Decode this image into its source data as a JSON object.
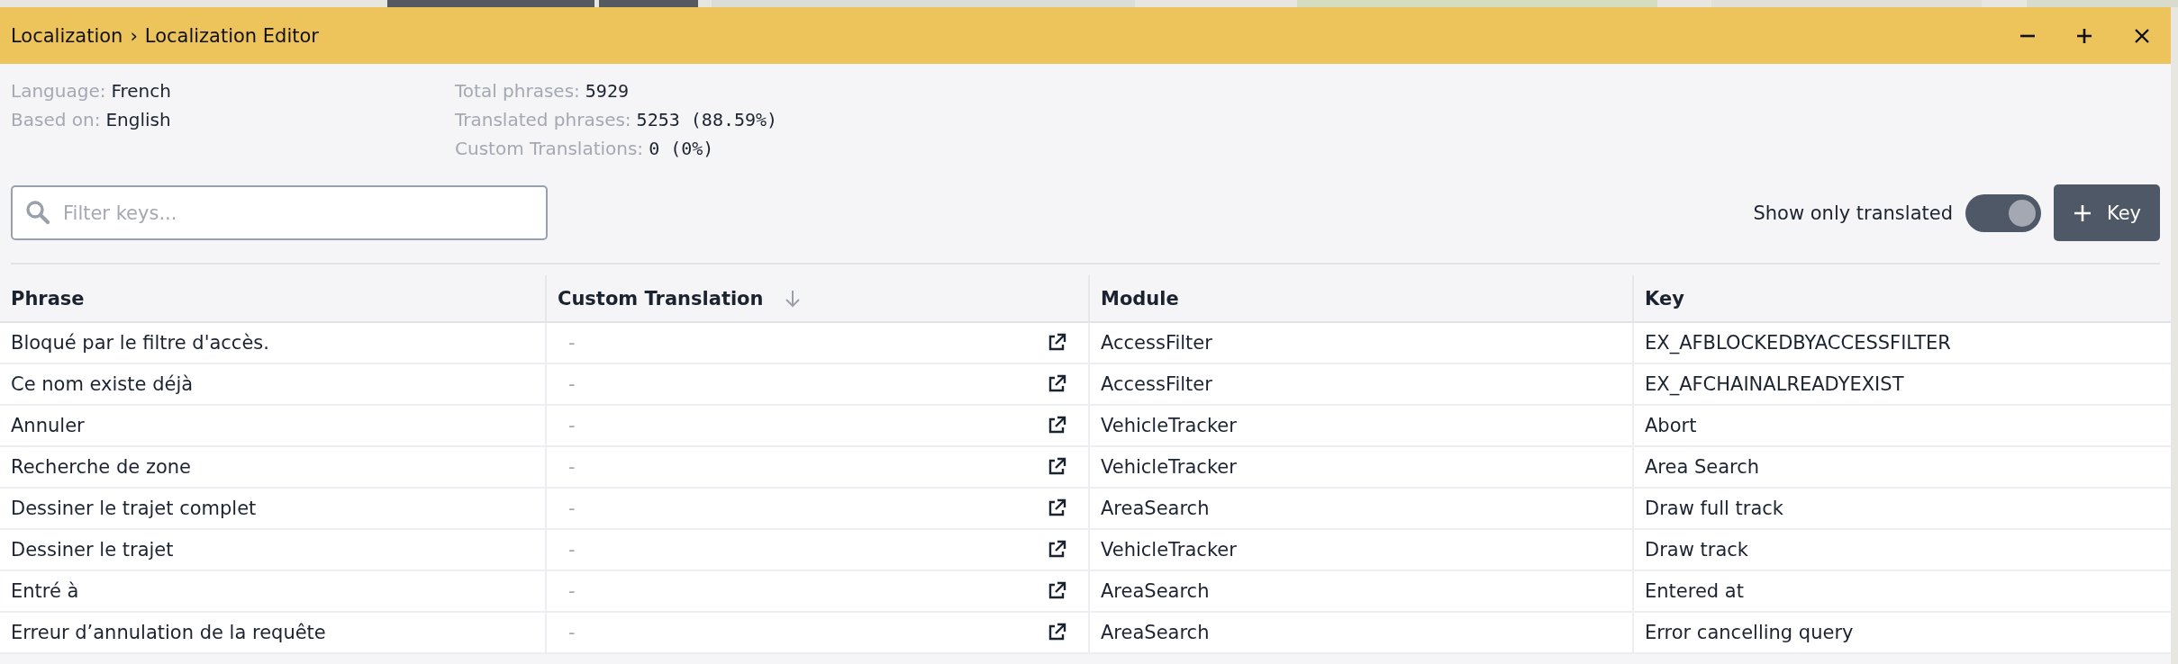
{
  "window": {
    "breadcrumb": [
      "Localization",
      "Localization Editor"
    ],
    "separator": "›",
    "controls": [
      {
        "kind": "minimize"
      },
      {
        "kind": "maximize"
      },
      {
        "kind": "close"
      }
    ]
  },
  "info_left": [
    {
      "label": "Language:",
      "value": "French"
    },
    {
      "label": "Based on:",
      "value": "English"
    }
  ],
  "info_right": [
    {
      "label": "Total phrases:",
      "value": "5929"
    },
    {
      "label": "Translated phrases:",
      "value": "5253 (88.59%)"
    },
    {
      "label": "Custom Translations:",
      "value": "0 (0%)"
    }
  ],
  "search": {
    "placeholder": "Filter keys..."
  },
  "toggle": {
    "label": "Show only translated",
    "on": true
  },
  "add_button": {
    "label": "Key"
  },
  "table": {
    "columns": [
      {
        "label": "Phrase",
        "sorted": false
      },
      {
        "label": "Custom Translation",
        "sorted": true
      },
      {
        "label": "Module",
        "sorted": false
      },
      {
        "label": "Key",
        "sorted": false
      }
    ],
    "rows": [
      {
        "phrase": "Bloqué par le filtre d'accès.",
        "custom": "-",
        "module": "AccessFilter",
        "key": "EX_AFBLOCKEDBYACCESSFILTER"
      },
      {
        "phrase": "Ce nom existe déjà",
        "custom": "-",
        "module": "AccessFilter",
        "key": "EX_AFCHAINALREADYEXIST"
      },
      {
        "phrase": "Annuler",
        "custom": "-",
        "module": "VehicleTracker",
        "key": "Abort"
      },
      {
        "phrase": "Recherche de zone",
        "custom": "-",
        "module": "VehicleTracker",
        "key": "Area Search"
      },
      {
        "phrase": "Dessiner le trajet complet",
        "custom": "-",
        "module": "AreaSearch",
        "key": "Draw full track"
      },
      {
        "phrase": "Dessiner le trajet",
        "custom": "-",
        "module": "VehicleTracker",
        "key": "Draw track"
      },
      {
        "phrase": "Entré à",
        "custom": "-",
        "module": "AreaSearch",
        "key": "Entered at"
      },
      {
        "phrase": "Erreur d’annulation de la requête",
        "custom": "-",
        "module": "AreaSearch",
        "key": "Error cancelling query"
      }
    ]
  }
}
